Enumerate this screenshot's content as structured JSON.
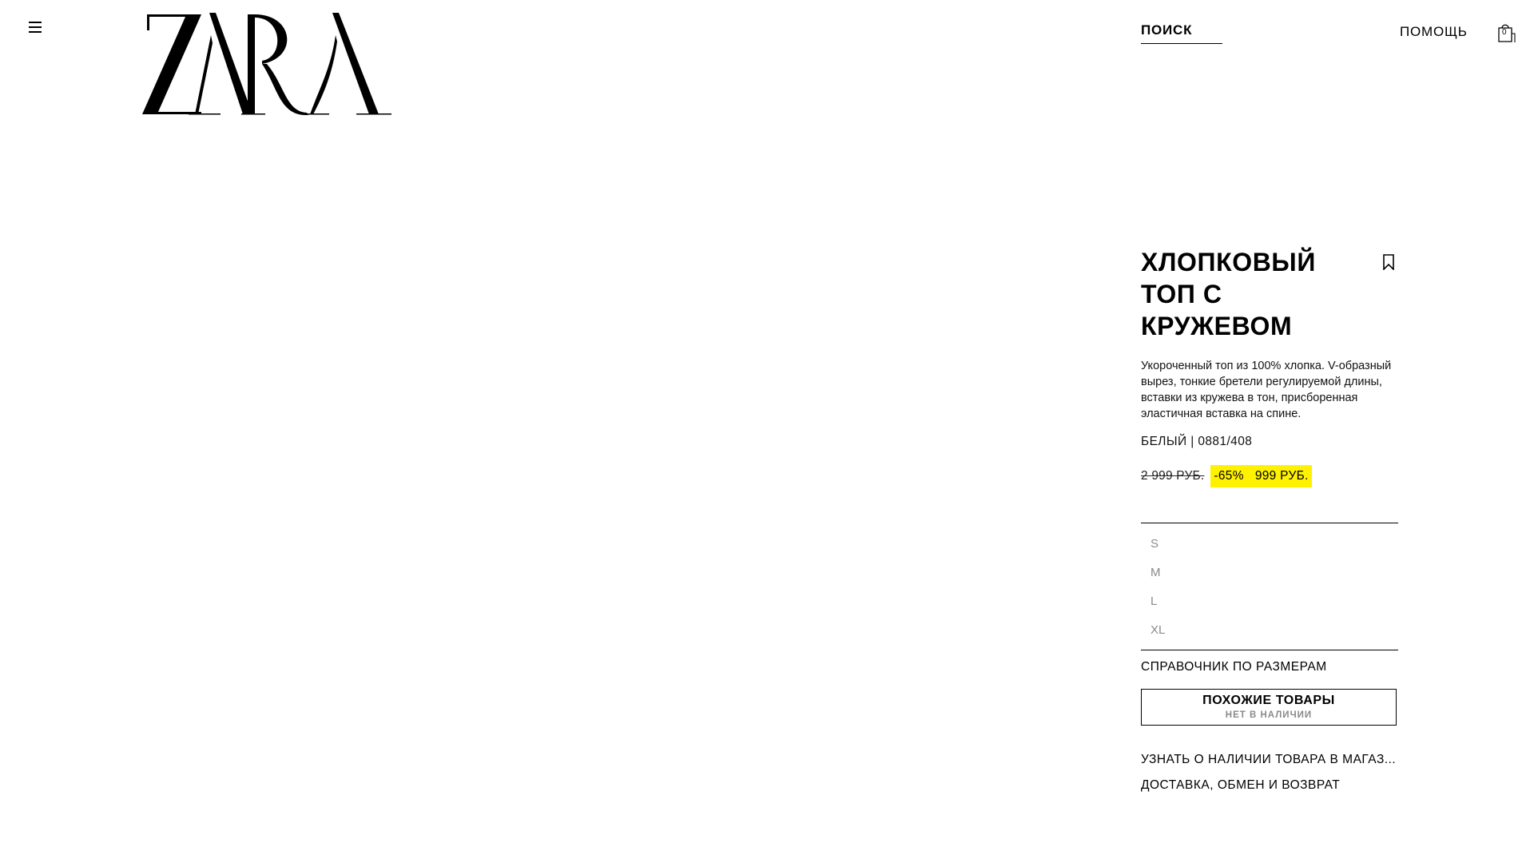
{
  "header": {
    "brand": "ZARA",
    "search_label": "ПОИСК",
    "help_label": "ПОМОЩЬ",
    "bag_count": "0",
    "icons": {
      "menu": "menu-icon",
      "bag": "shopping-bag-icon"
    }
  },
  "product": {
    "title": "ХЛОПКОВЫЙ ТОП С КРУЖЕВОМ",
    "description": "Укороченный топ из 100% хлопка. V-образный вырез, тонкие бретели регулируемой длины, вставки из кружева в тон, присборенная эластичная вставка на спине.",
    "color_ref": "БЕЛЫЙ | 0881/408",
    "old_price": "2 999 РУБ.",
    "discount": "-65%",
    "price": "999 РУБ.",
    "sale_color": "#fff200",
    "sizes": [
      "S",
      "M",
      "L",
      "XL"
    ],
    "size_guide_label": "СПРАВОЧНИК ПО РАЗМЕРАМ",
    "similar_label": "ПОХОЖИЕ ТОВАРЫ",
    "similar_sub": "НЕТ В НАЛИЧИИ",
    "store_label": "УЗНАТЬ О НАЛИЧИИ ТОВАРА В МАГАЗ...",
    "delivery_label": "ДОСТАВКА, ОБМЕН И ВОЗВРАТ",
    "bookmark_icon": "bookmark-icon"
  }
}
